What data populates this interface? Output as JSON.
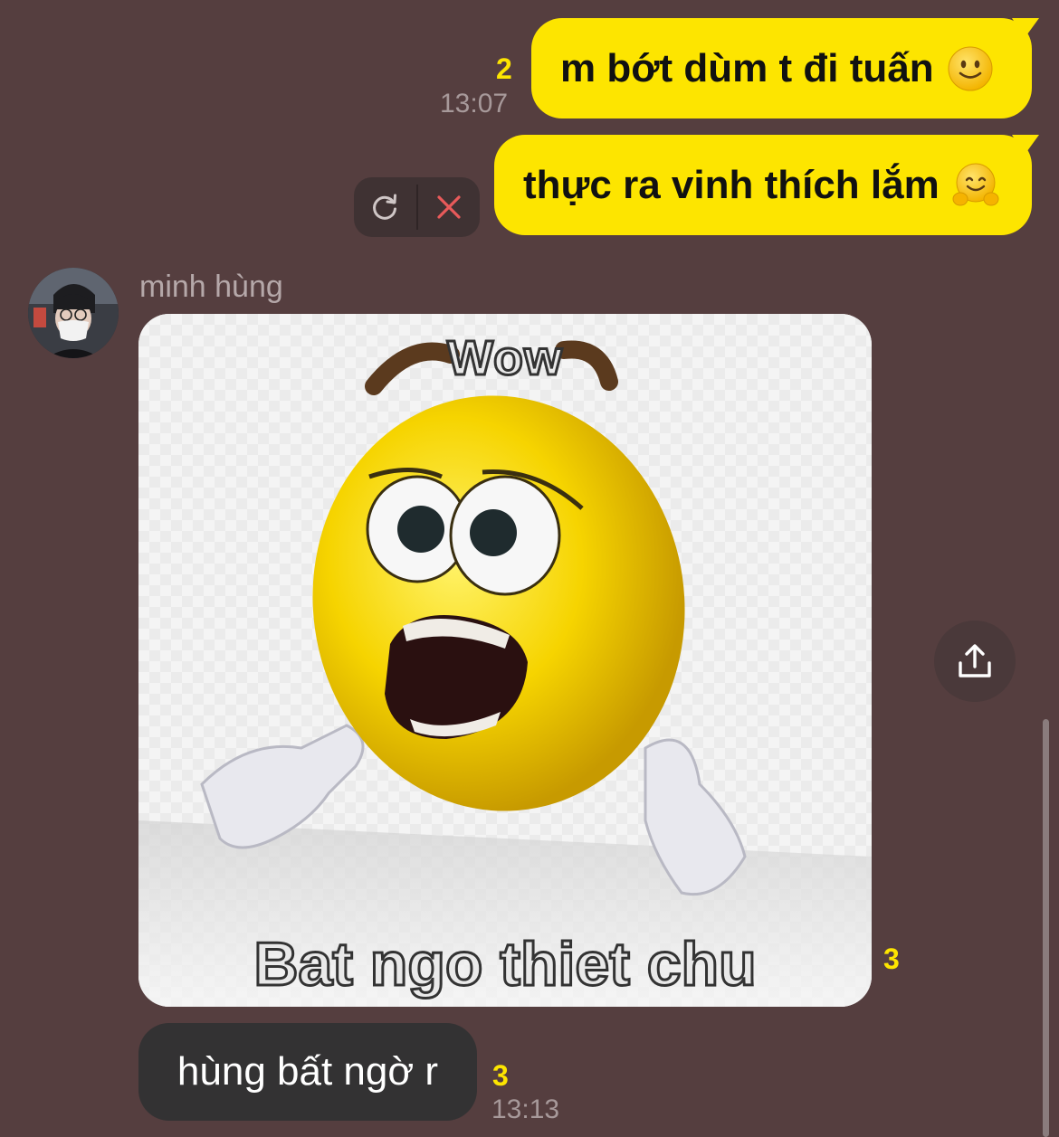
{
  "messages_out": [
    {
      "text": "m bớt dùm t đi tuấn",
      "emoji": "slightly-smiling-face-emoji",
      "read_count": "2",
      "time": "13:07"
    },
    {
      "text": "thực ra vinh thích lắm",
      "emoji": "hugging-face-emoji"
    }
  ],
  "failed_actions": {
    "retry_icon": "refresh-icon",
    "cancel_icon": "close-icon"
  },
  "incoming": {
    "sender": "minh hùng",
    "image": {
      "top_text": "Wow",
      "bottom_text": "Bat ngo thiet chu",
      "read_count": "3"
    },
    "text_message": {
      "text": "hùng bất ngờ r",
      "read_count": "3",
      "time": "13:13"
    }
  },
  "share_icon": "share-upload-icon",
  "colors": {
    "background": "#553e3f",
    "bubble_out": "#fde500",
    "bubble_in": "#333233",
    "accent": "#fde500"
  }
}
